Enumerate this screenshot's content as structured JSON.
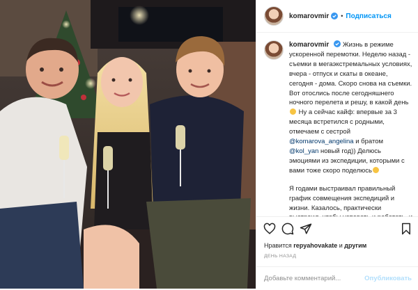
{
  "post": {
    "username": "komarovmir",
    "follow_label": "Подписаться",
    "caption": {
      "username": "komarovmir",
      "p1_a": "Жизнь в режиме ускоренной перемотки. Неделю назад - съемки в мегаэкстремальных условиях, вчера - отпуск и скаты в океане, сегодня - дома. Скоро снова на съемки. Вот отослись после сегодняшнего ночного перелета и решу, в какой день",
      "p1_b": " Ну а сейчас кайф: впервые за 3 месяца встретился с родными, отмечаем с сестрой ",
      "mention1": "@komarova_angelina",
      "p1_c": " и братом ",
      "mention2": "@kol_yan",
      "p1_d": " новый год)) Делюсь эмоциями из экспедиции, которыми с вами тоже скоро поделюсь",
      "p2": "Я годами выстраивал правильный график совмещения экспедиций и жизни. Казалось, практически выстроил, чтобы успевать и работать, и жить, по крайней мере был на пути"
    },
    "likes": {
      "prefix": "Нравится ",
      "user": "repyahovakate",
      "and": " и ",
      "others": "другим"
    },
    "time_ago": "ДЕНЬ НАЗАД",
    "comment": {
      "placeholder": "Добавьте комментарий...",
      "publish_label": "Опубликовать"
    },
    "icons": [
      "heart-icon",
      "comment-icon",
      "share-icon",
      "bookmark-icon",
      "verified-icon",
      "emoji-icon"
    ],
    "colors": {
      "accent": "#0095f6",
      "mention": "#00376b",
      "muted": "#8e8e8e",
      "publish_disabled": "#b2dffc"
    }
  }
}
